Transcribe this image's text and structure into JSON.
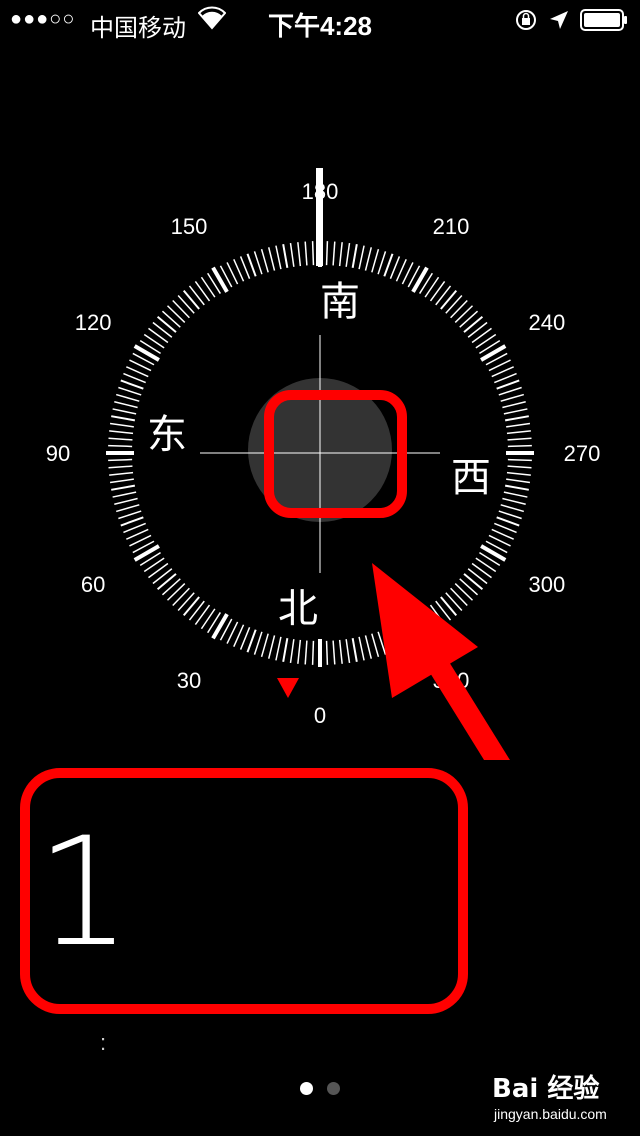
{
  "status_bar": {
    "signal": "●●●○○",
    "carrier": "中国移动",
    "time": "下午4:28",
    "wifi_icon": "wifi-icon",
    "lock_icon": "rotation-lock-icon",
    "location_icon": "location-arrow-icon",
    "battery_icon": "battery-icon"
  },
  "compass": {
    "heading_degrees": 180,
    "cardinals": {
      "north": "北",
      "south": "南",
      "east": "东",
      "west": "西"
    },
    "degree_labels": [
      "0",
      "30",
      "60",
      "90",
      "120",
      "150",
      "180",
      "210",
      "240",
      "270",
      "300",
      "330"
    ]
  },
  "reading": {
    "value": "1",
    "subtext": ":"
  },
  "pager": {
    "total": 2,
    "active": 0
  },
  "watermark": {
    "logo": "Bai 经验",
    "url": "jingyan.baidu.com"
  },
  "colors": {
    "background": "#000000",
    "accent_red": "#ff0000",
    "text": "#ffffff",
    "level_disc": "#333333"
  }
}
